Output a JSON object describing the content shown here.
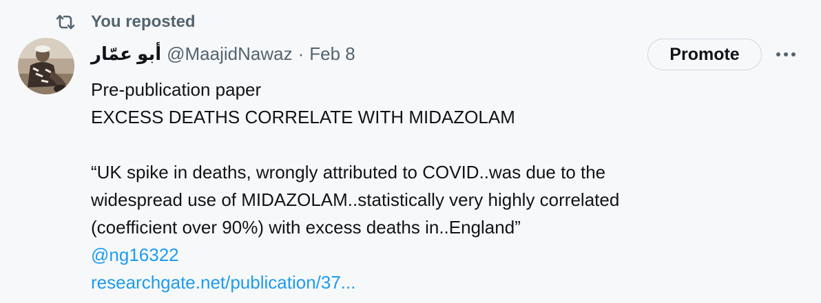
{
  "social_context": {
    "repost_text": "You reposted",
    "icon": "repost-icon"
  },
  "author": {
    "display_name": "أبو عمّار",
    "handle": "@MaajidNawaz",
    "separator": "·",
    "date": "Feb 8",
    "avatar": "avatar"
  },
  "actions": {
    "promote_label": "Promote",
    "more_icon": "more-icon"
  },
  "tweet": {
    "lines": [
      "Pre-publication paper",
      "EXCESS DEATHS CORRELATE WITH MIDAZOLAM",
      "",
      "“UK spike in deaths, wrongly attributed to COVID..was due to the",
      "widespread use of MIDAZOLAM..statistically very highly correlated",
      "(coefficient over 90%) with excess deaths in..England”"
    ],
    "mention": "@ng16322",
    "link": "researchgate.net/publication/37..."
  },
  "colors": {
    "background": "#f7f8f9",
    "text": "#0f1419",
    "secondary": "#536471",
    "link": "#1d9bf0",
    "border": "#cfd9de"
  }
}
